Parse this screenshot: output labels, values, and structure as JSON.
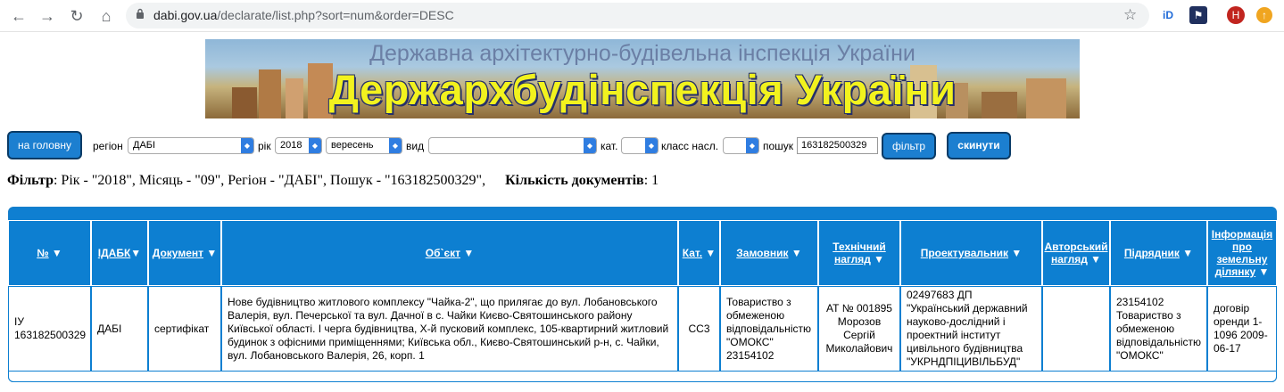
{
  "browser": {
    "url_domain": "dabi.gov.ua",
    "url_path": "/declarate/list.php?sort=num&order=DESC",
    "profile_initial": "Н"
  },
  "banner": {
    "subtitle": "Державна архітектурно-будівельна інспекція України",
    "title": "Держархбудінспекція України"
  },
  "filters": {
    "home_label": "на головну",
    "region_label": "регіон",
    "region_value": "ДАБІ",
    "year_label": "рік",
    "year_value": "2018",
    "month_value": "вересень",
    "type_label": "вид",
    "type_value": "",
    "cat_label": "кат.",
    "cat_value": "",
    "class_label": "класс насл.",
    "class_value": "",
    "search_label": "пошук",
    "search_value": "163182500329",
    "filter_button": "фільтр",
    "reset_button": "скинути"
  },
  "summary": {
    "filter_title": "Фільтр",
    "filter_text": ": Рік - \"2018\", Місяць - \"09\", Регіон - \"ДАБІ\", Пошук - \"163182500329\",",
    "count_title": "Кількість документів",
    "count_text": ": 1"
  },
  "table": {
    "headers": [
      "№",
      "ІДАБК",
      "Документ",
      "Об`єкт",
      "Кат.",
      "Замовник",
      "Технічний нагляд",
      "Проектувальник",
      "Авторський нагляд",
      "Підрядник",
      "Інформація про земельну ділянку"
    ],
    "rows": [
      [
        "ІУ 163182500329",
        "ДАБІ",
        "сертифікат",
        "Нове будівництво житлового комплексу \"Чайка-2\", що прилягає до вул. Лобановського Валерія, вул. Печерської та вул. Дачної в с. Чайки Києво-Святошинського району Київської області. І черга будівництва, Х-й пусковий комплекс, 105-квартирний житловий будинок з офісними приміщеннями; Київська обл., Києво-Святошинський р-н, с. Чайки, вул. Лобановського Валерія, 26, корп. 1",
        "СС3",
        "Товариство з обмеженою відповідальністю \"ОМОКС\" 23154102",
        "АТ № 001895 Морозов Сергій Миколайович",
        "02497683 ДП \"Український державний науково-дослідний і проектний інститут цивільного будівництва \"УКРНДПІЦИВІЛЬБУД\"",
        "",
        "23154102 Товариство з обмеженою відповідальністю \"ОМОКС\"",
        "договір оренди 1-1096 2009-06-17"
      ]
    ]
  }
}
